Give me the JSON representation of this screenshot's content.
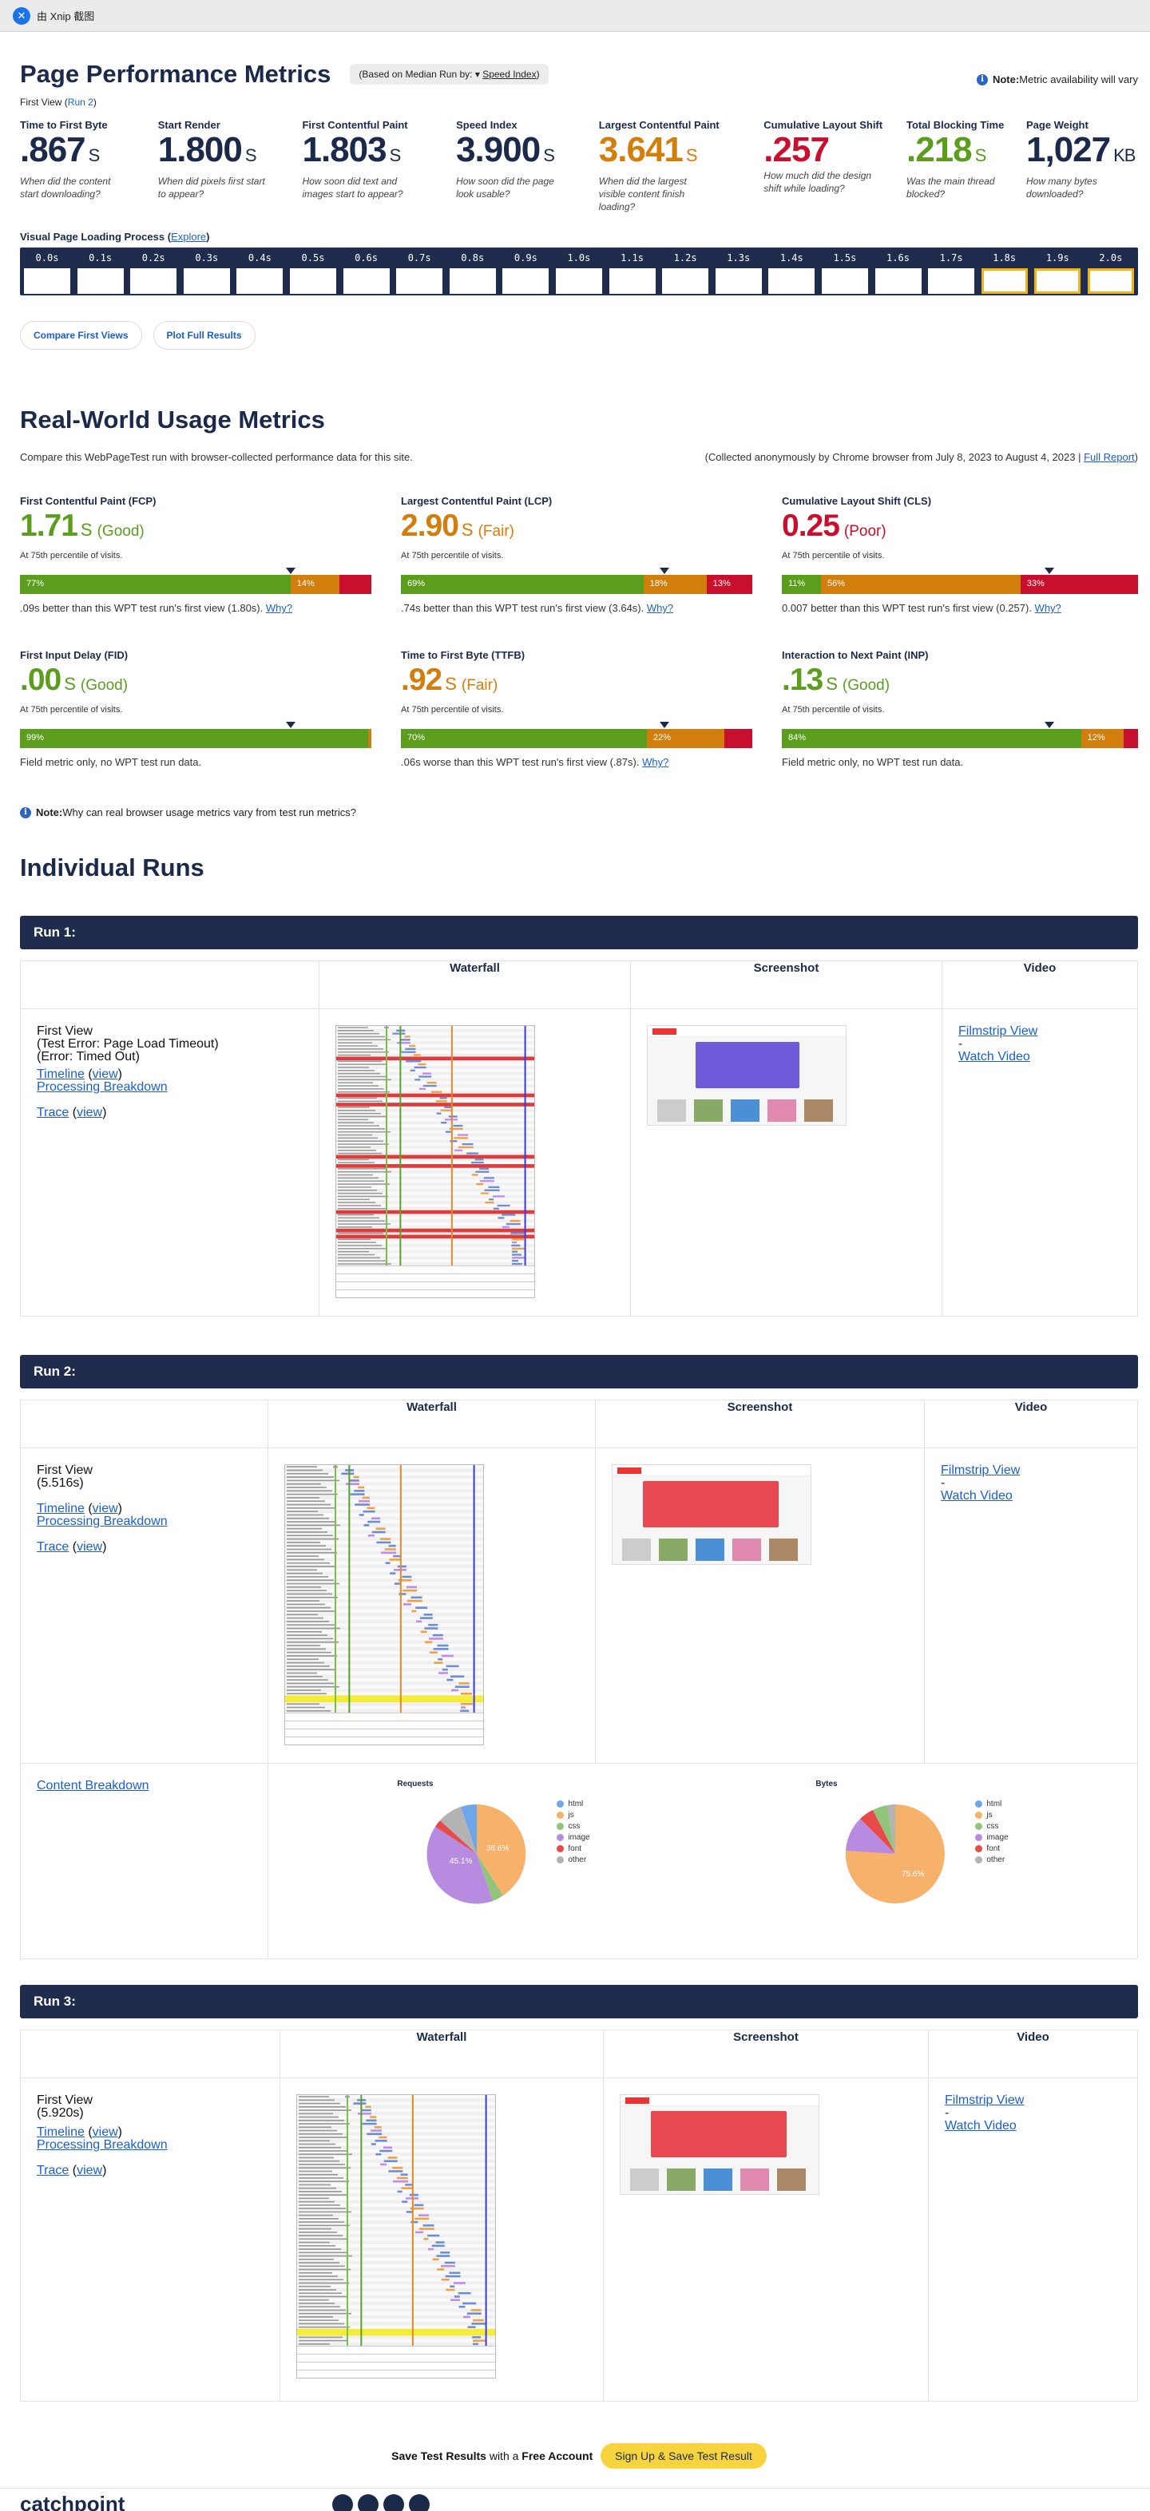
{
  "topbar": {
    "title": "由 Xnip 截图"
  },
  "perf": {
    "title": "Page Performance Metrics",
    "median_prefix": "(Based on Median Run by: ",
    "median_select": "Speed Index",
    "median_suffix": ")",
    "note_label": "Note:",
    "note_text": " Metric availability will vary",
    "fv_prefix": "First View (",
    "fv_link": "Run 2",
    "fv_suffix": ")",
    "metrics": [
      {
        "label": "Time to First Byte",
        "value": ".867",
        "unit": "S",
        "q": "When did the content start downloading?",
        "status": "nav"
      },
      {
        "label": "Start Render",
        "value": "1.800",
        "unit": "S",
        "q": "When did pixels first start to appear?",
        "status": "nav"
      },
      {
        "label": "First Contentful Paint",
        "value": "1.803",
        "unit": "S",
        "q": "How soon did text and images start to appear?",
        "status": "nav"
      },
      {
        "label": "Speed Index",
        "value": "3.900",
        "unit": "S",
        "q": "How soon did the page look usable?",
        "status": "nav"
      },
      {
        "label": "Largest Contentful Paint",
        "value": "3.641",
        "unit": "S",
        "q": "When did the largest visible content finish loading?",
        "status": "fair"
      },
      {
        "label": "Cumulative Layout Shift",
        "value": ".257",
        "unit": "",
        "q": "How much did the design shift while loading?",
        "status": "poor"
      },
      {
        "label": "Total Blocking Time",
        "value": ".218",
        "unit": "S",
        "q": "Was the main thread blocked?",
        "status": "good"
      },
      {
        "label": "Page Weight",
        "value": "1,027",
        "unit": "KB",
        "q": "How many bytes downloaded?",
        "status": "nav"
      }
    ],
    "vplp_label": "Visual Page Loading Process",
    "vplp_link": "Explore",
    "frames": [
      "0.0s",
      "0.1s",
      "0.2s",
      "0.3s",
      "0.4s",
      "0.5s",
      "0.6s",
      "0.7s",
      "0.8s",
      "0.9s",
      "1.0s",
      "1.1s",
      "1.2s",
      "1.3s",
      "1.4s",
      "1.5s",
      "1.6s",
      "1.7s",
      "1.8s",
      "1.9s",
      "2.0s"
    ],
    "buttons": [
      "Compare First Views",
      "Plot Full Results"
    ]
  },
  "rw": {
    "title": "Real-World Usage Metrics",
    "intro": "Compare this WebPageTest run with browser-collected performance data for this site.",
    "collected": "(Collected anonymously by Chrome browser from July 8, 2023 to August 4, 2023 | ",
    "full_report": "Full Report",
    "collected_end": ")",
    "cards": [
      {
        "label": "First Contentful Paint (FCP)",
        "value": "1.71",
        "unit": "S",
        "rating": "(Good)",
        "status": "good",
        "pct": "At 75th percentile of visits.",
        "good": 77,
        "fair": 14,
        "poor": 9,
        "good_t": "77%",
        "fair_t": "14%",
        "poor_t": "",
        "marker": 77,
        "cmp": ".09s better than this WPT test run's first view (1.80s).",
        "why": "Why?"
      },
      {
        "label": "Largest Contentful Paint (LCP)",
        "value": "2.90",
        "unit": "S",
        "rating": "(Fair)",
        "status": "fair",
        "pct": "At 75th percentile of visits.",
        "good": 69,
        "fair": 18,
        "poor": 13,
        "good_t": "69%",
        "fair_t": "18%",
        "poor_t": "13%",
        "marker": 75,
        "cmp": ".74s better than this WPT test run's first view (3.64s).",
        "why": "Why?"
      },
      {
        "label": "Cumulative Layout Shift (CLS)",
        "value": "0.25",
        "unit": "",
        "rating": "(Poor)",
        "status": "poor",
        "pct": "At 75th percentile of visits.",
        "good": 11,
        "fair": 56,
        "poor": 33,
        "good_t": "11%",
        "fair_t": "56%",
        "poor_t": "33%",
        "marker": 75,
        "cmp": "0.007 better than this WPT test run's first view (0.257).",
        "why": "Why?"
      },
      {
        "label": "First Input Delay (FID)",
        "value": ".00",
        "unit": "S",
        "rating": "(Good)",
        "status": "good",
        "pct": "At 75th percentile of visits.",
        "good": 99,
        "fair": 1,
        "poor": 0,
        "good_t": "99%",
        "fair_t": "",
        "poor_t": "",
        "marker": 77,
        "cmp": "Field metric only, no WPT test run data.",
        "why": ""
      },
      {
        "label": "Time to First Byte (TTFB)",
        "value": ".92",
        "unit": "S",
        "rating": "(Fair)",
        "status": "fair",
        "pct": "At 75th percentile of visits.",
        "good": 70,
        "fair": 22,
        "poor": 8,
        "good_t": "70%",
        "fair_t": "22%",
        "poor_t": "",
        "marker": 75,
        "cmp": ".06s worse than this WPT test run's first view (.87s).",
        "why": "Why?"
      },
      {
        "label": "Interaction to Next Paint (INP)",
        "value": ".13",
        "unit": "S",
        "rating": "(Good)",
        "status": "good",
        "pct": "At 75th percentile of visits.",
        "good": 84,
        "fair": 12,
        "poor": 4,
        "good_t": "84%",
        "fair_t": "12%",
        "poor_t": "",
        "marker": 75,
        "cmp": "Field metric only, no WPT test run data.",
        "why": ""
      }
    ],
    "note_label": "Note:",
    "note_text": " Why can real browser usage metrics vary from test run metrics?"
  },
  "runs": {
    "title": "Individual Runs",
    "col_waterfall": "Waterfall",
    "col_screenshot": "Screenshot",
    "col_video": "Video",
    "first_view": "First View",
    "timeline": "Timeline",
    "view": "view",
    "processing": "Processing Breakdown",
    "trace": "Trace",
    "filmstrip": "Filmstrip View",
    "dash": "-",
    "watch": "Watch Video",
    "content_breakdown": "Content Breakdown",
    "run1": {
      "title": "Run 1:",
      "l1": "(Test Error: Page Load Timeout)",
      "l2": "(Error: Timed Out)"
    },
    "run2": {
      "title": "Run 2:",
      "l1": "(5.516s)"
    },
    "run3": {
      "title": "Run 3:",
      "l1": "(5.920s)"
    },
    "pie_requests": "Requests",
    "pie_bytes": "Bytes",
    "legend": [
      "html",
      "js",
      "css",
      "image",
      "font",
      "other"
    ],
    "req_image_pct": "45.1%",
    "req_js_pct": "36.6%",
    "bytes_js_pct": "75.6%"
  },
  "footer": {
    "save_prefix": "Save Test Results",
    "with": " with a ",
    "free": "Free Account",
    "signup": "Sign Up & Save Test Result",
    "brand": "catchpoint"
  },
  "colors": {
    "good": "#5b9d1c",
    "fair": "#d17e0c",
    "poor": "#c8102e",
    "nav": "#202c4e",
    "html": "#6ea6e8",
    "js": "#f6b26b",
    "css": "#93c47d",
    "image": "#b78be0",
    "font": "#e84a4a",
    "other": "#b3b3b3"
  }
}
